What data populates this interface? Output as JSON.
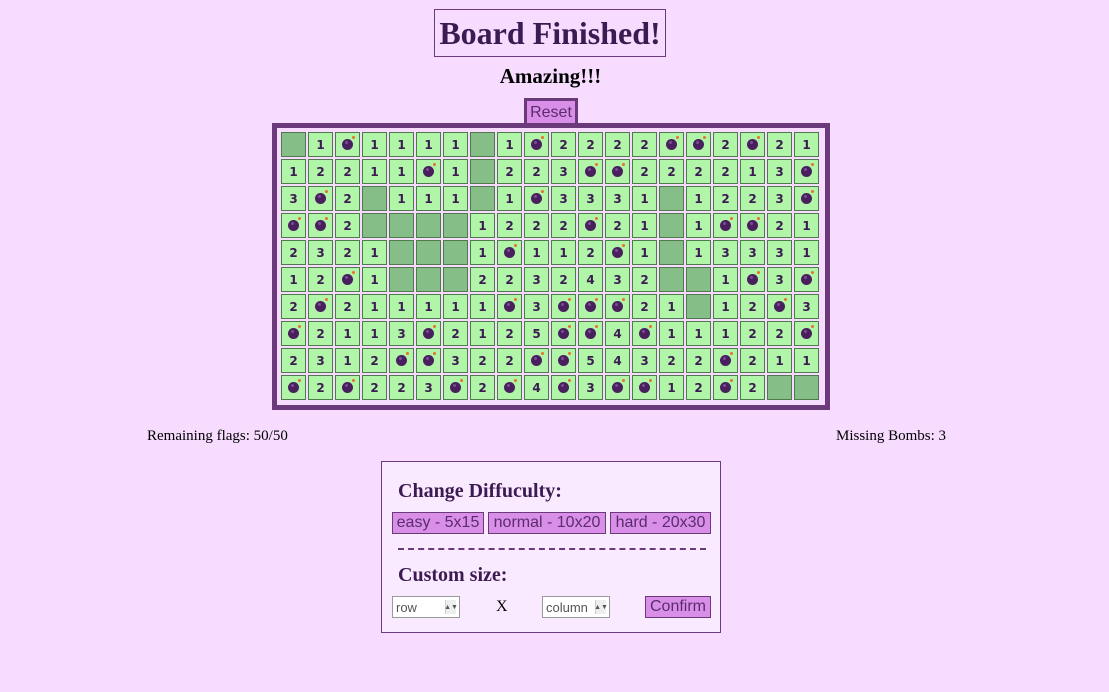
{
  "header": {
    "title": "Board Finished!",
    "subtitle": "Amazing!!!",
    "reset_label": "Reset"
  },
  "board": {
    "rows": 10,
    "columns": 20,
    "cells": [
      [
        " ",
        "1",
        "B",
        "1",
        "1",
        "1",
        "1",
        " ",
        "1",
        "B",
        "2",
        "2",
        "2",
        "2",
        "B",
        "B",
        "2",
        "B",
        "2",
        "1"
      ],
      [
        "1",
        "2",
        "2",
        "1",
        "1",
        "B",
        "1",
        " ",
        "2",
        "2",
        "3",
        "B",
        "B",
        "2",
        "2",
        "2",
        "2",
        "1",
        "3",
        "B"
      ],
      [
        "3",
        "B",
        "2",
        " ",
        "1",
        "1",
        "1",
        " ",
        "1",
        "B",
        "3",
        "3",
        "3",
        "1",
        " ",
        "1",
        "2",
        "2",
        "3",
        "B"
      ],
      [
        "B",
        "B",
        "2",
        " ",
        " ",
        " ",
        " ",
        "1",
        "2",
        "2",
        "2",
        "B",
        "2",
        "1",
        " ",
        "1",
        "B",
        "B",
        "2",
        "1"
      ],
      [
        "2",
        "3",
        "2",
        "1",
        " ",
        " ",
        " ",
        "1",
        "B",
        "1",
        "1",
        "2",
        "B",
        "1",
        " ",
        "1",
        "3",
        "3",
        "3",
        "1"
      ],
      [
        "1",
        "2",
        "B",
        "1",
        " ",
        " ",
        " ",
        "2",
        "2",
        "3",
        "2",
        "4",
        "3",
        "2",
        " ",
        " ",
        "1",
        "B",
        "3",
        "B"
      ],
      [
        "2",
        "B",
        "2",
        "1",
        "1",
        "1",
        "1",
        "1",
        "B",
        "3",
        "B",
        "B",
        "B",
        "2",
        "1",
        " ",
        "1",
        "2",
        "B",
        "3"
      ],
      [
        "B",
        "2",
        "1",
        "1",
        "3",
        "B",
        "2",
        "1",
        "2",
        "5",
        "B",
        "B",
        "4",
        "B",
        "1",
        "1",
        "1",
        "2",
        "2",
        "B"
      ],
      [
        "2",
        "3",
        "1",
        "2",
        "B",
        "B",
        "3",
        "2",
        "2",
        "B",
        "B",
        "5",
        "4",
        "3",
        "2",
        "2",
        "B",
        "2",
        "1",
        "1"
      ],
      [
        "B",
        "2",
        "B",
        "2",
        "2",
        "3",
        "B",
        "2",
        "B",
        "4",
        "B",
        "3",
        "B",
        "B",
        "1",
        "2",
        "B",
        "2",
        " ",
        " "
      ]
    ]
  },
  "status": {
    "remaining_flags": "Remaining flags: 50/50",
    "missing_bombs": "Missing Bombs: 3"
  },
  "settings": {
    "difficulty_heading": "Change Diffuculty:",
    "easy_label": "easy - 5x15",
    "normal_label": "normal - 10x20",
    "hard_label": "hard - 20x30",
    "custom_heading": "Custom size:",
    "row_placeholder": "row",
    "x_label": "X",
    "column_placeholder": "column",
    "confirm_label": "Confirm"
  },
  "colors": {
    "background": "#f7dcff",
    "accent": "#6b3a7a",
    "button": "#d98fe8",
    "cell": "#b0f5a8",
    "cell_blank": "#85bf87"
  }
}
